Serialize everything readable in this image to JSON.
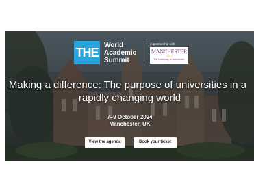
{
  "brand": {
    "logo_text": "THE",
    "summit_name": [
      "World",
      "Academic",
      "Summit"
    ]
  },
  "partner": {
    "label": "in partnership with",
    "logo_word": "MANCHESTER",
    "logo_year": "1824",
    "logo_sub": "The University of Manchester"
  },
  "headline": {
    "line1": "Making a difference: The purpose of universities in a",
    "line2": "rapidly changing world"
  },
  "event": {
    "dates": "7–9 October 2024",
    "location": "Manchester, UK"
  },
  "actions": {
    "agenda": "View the agenda",
    "ticket": "Book your ticket"
  },
  "colors": {
    "the_blue": "#29a3db",
    "manchester_purple": "#6b2c7e",
    "manchester_gold": "#f0b400"
  }
}
